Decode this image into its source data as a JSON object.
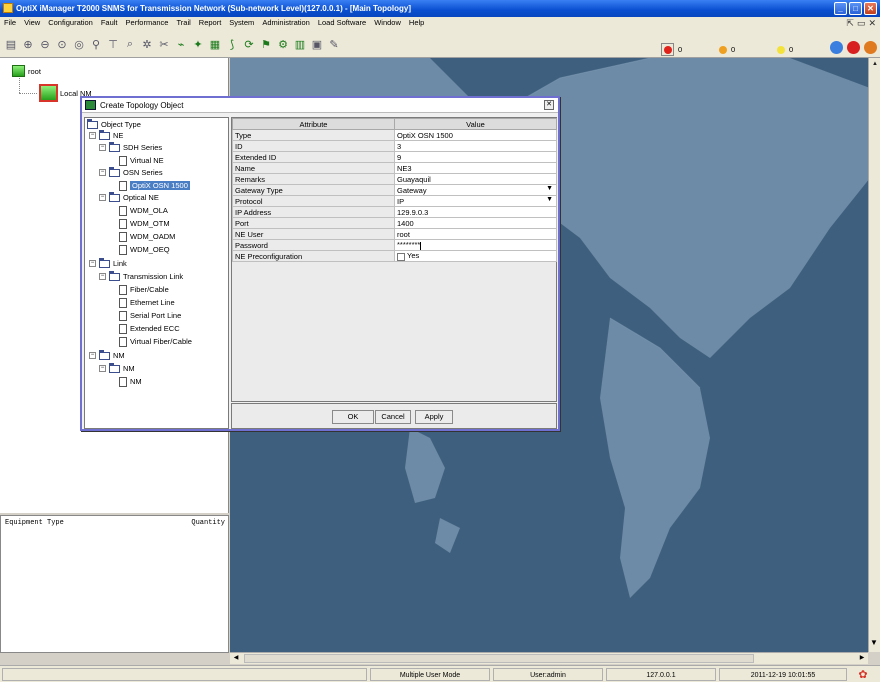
{
  "window": {
    "title": "OptiX iManager T2000 SNMS for Transmission Network (Sub-network Level)(127.0.0.1) - [Main Topology]"
  },
  "menu": [
    "File",
    "View",
    "Configuration",
    "Fault",
    "Performance",
    "Trail",
    "Report",
    "System",
    "Administration",
    "Load Software",
    "Window",
    "Help"
  ],
  "alarms": [
    {
      "count": "0",
      "color": "#e0221a"
    },
    {
      "count": "0",
      "color": "#f0a020"
    },
    {
      "count": "0",
      "color": "#f2e23a"
    }
  ],
  "topology": {
    "root": "root",
    "child": "Local NM"
  },
  "equipment_panel": {
    "col1": "Equipment Type",
    "col2": "Quantity"
  },
  "dialog": {
    "title": "Create Topology Object",
    "tree": {
      "object_type": "Object Type",
      "ne": "NE",
      "sdh_series": "SDH Series",
      "virtual_ne": "Virtual NE",
      "osn_series": "OSN Series",
      "optix_osn_1500": "OptiX OSN 1500",
      "optical_ne": "Optical NE",
      "wdm_ola": "WDM_OLA",
      "wdm_otm": "WDM_OTM",
      "wdm_oadm": "WDM_OADM",
      "wdm_oeq": "WDM_OEQ",
      "link": "Link",
      "transmission_link": "Transmission Link",
      "fiber_cable": "Fiber/Cable",
      "ethernet_line": "Ethernet Line",
      "serial_port_line": "Serial Port Line",
      "extended_ecc": "Extended ECC",
      "virtual_fiber_cable": "Virtual Fiber/Cable",
      "nm": "NM",
      "nm_sub": "NM",
      "nm_leaf": "NM"
    },
    "table": {
      "headers": {
        "attribute": "Attribute",
        "value": "Value"
      },
      "rows": [
        {
          "attr": "Type",
          "value": "OptiX OSN 1500"
        },
        {
          "attr": "ID",
          "value": "3"
        },
        {
          "attr": "Extended ID",
          "value": "9"
        },
        {
          "attr": "Name",
          "value": "NE3"
        },
        {
          "attr": "Remarks",
          "value": "Guayaquil"
        },
        {
          "attr": "Gateway Type",
          "value": "Gateway"
        },
        {
          "attr": "Protocol",
          "value": "IP"
        },
        {
          "attr": "IP Address",
          "value": "129.9.0.3"
        },
        {
          "attr": "Port",
          "value": "1400"
        },
        {
          "attr": "NE User",
          "value": "root"
        },
        {
          "attr": "Password",
          "value": "********"
        },
        {
          "attr": "NE Preconfiguration",
          "value": "Yes"
        }
      ]
    },
    "buttons": {
      "ok": "OK",
      "cancel": "Cancel",
      "apply": "Apply"
    }
  },
  "status": {
    "mode": "Multiple User Mode",
    "user": "User:admin",
    "ip": "127.0.0.1",
    "datetime": "2011-12-19 10:01:55"
  }
}
